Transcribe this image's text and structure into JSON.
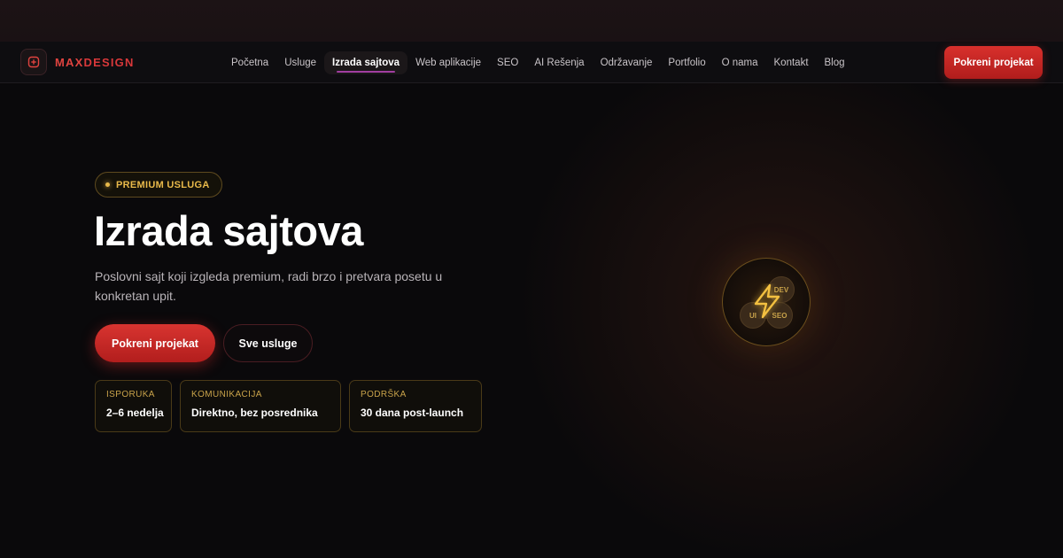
{
  "brand": {
    "part1": "MAX",
    "part2": "DESIGN"
  },
  "nav": {
    "items": [
      {
        "label": "Početna"
      },
      {
        "label": "Usluge"
      },
      {
        "label": "Izrada sajtova",
        "active": true
      },
      {
        "label": "Web aplikacije"
      },
      {
        "label": "SEO"
      },
      {
        "label": "AI Rešenja"
      },
      {
        "label": "Održavanje"
      },
      {
        "label": "Portfolio"
      },
      {
        "label": "O nama"
      },
      {
        "label": "Kontakt"
      },
      {
        "label": "Blog"
      }
    ],
    "cta_label": "Pokreni projekat"
  },
  "hero": {
    "badge": "PREMIUM USLUGA",
    "title": "Izrada sajtova",
    "subtitle": "Poslovni sajt koji izgleda premium, radi brzo i pretvara posetu u konkretan upit.",
    "primary_button": "Pokreni projekat",
    "secondary_button": "Sve usluge"
  },
  "stats": [
    {
      "label": "ISPORUKA",
      "value": "2–6 nedelja"
    },
    {
      "label": "KOMUNIKACIJA",
      "value": "Direktno, bez posrednika"
    },
    {
      "label": "PODRŠKA",
      "value": "30 dana post-launch"
    }
  ],
  "emblem": {
    "chips": [
      "DEV",
      "UI",
      "SEO"
    ],
    "icon": "lightning-bolt-icon"
  },
  "colors": {
    "accent_red": "#d8302c",
    "accent_gold": "#e8b94a",
    "active_underline": "#a13ea0",
    "background": "#0a090b"
  }
}
